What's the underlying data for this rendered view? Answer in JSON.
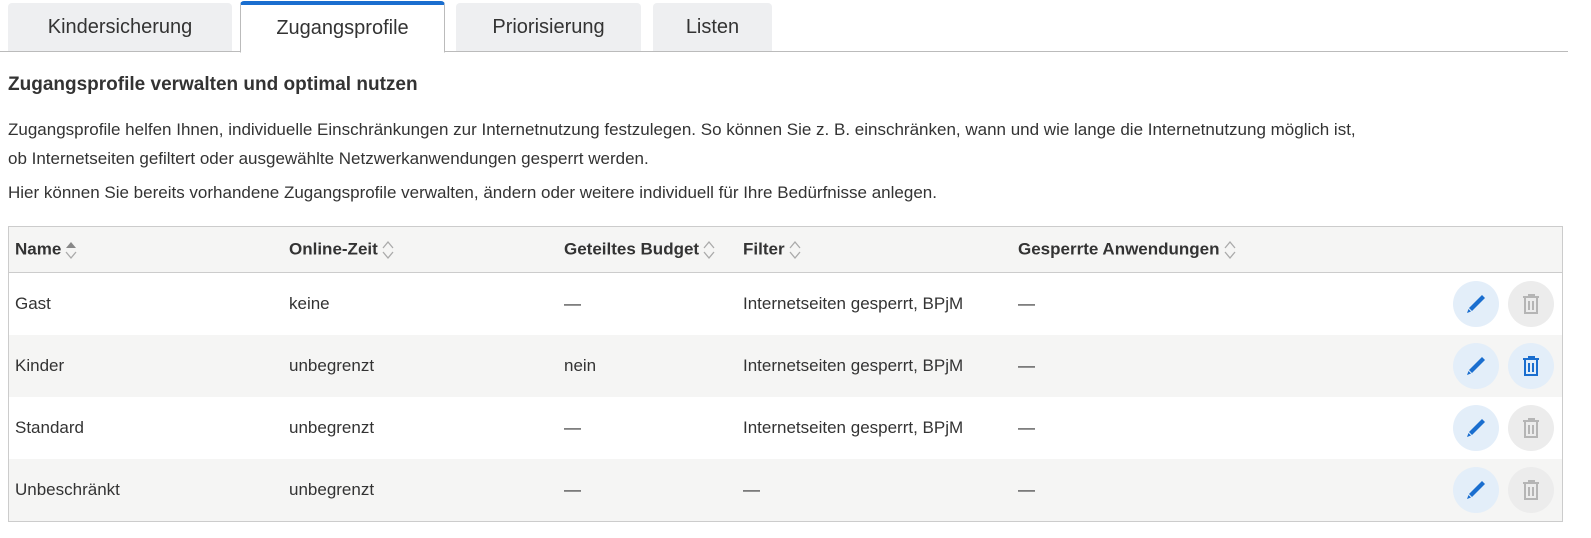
{
  "tabs": [
    {
      "label": "Kindersicherung"
    },
    {
      "label": "Zugangsprofile",
      "active": true
    },
    {
      "label": "Priorisierung"
    },
    {
      "label": "Listen"
    }
  ],
  "heading": "Zugangsprofile verwalten und optimal nutzen",
  "intro1": "Zugangsprofile helfen Ihnen, individuelle Einschränkungen zur Internetnutzung festzulegen. So können Sie z. B. einschränken, wann und wie lange die Internetnutzung möglich ist,",
  "intro2": "ob Internetseiten gefiltert oder ausgewählte Netzwerkanwendungen gesperrt werden.",
  "intro3": "Hier können Sie bereits vorhandene Zugangsprofile verwalten, ändern oder weitere individuell für Ihre Bedürfnisse anlegen.",
  "columns": [
    "Name",
    "Online-Zeit",
    "Geteiltes Budget",
    "Filter",
    "Gesperrte Anwendungen"
  ],
  "rows": [
    {
      "name": "Gast",
      "online": "keine",
      "budget": "—",
      "filter": "Internetseiten gesperrt, BPjM",
      "apps": "—",
      "deletable": false
    },
    {
      "name": "Kinder",
      "online": "unbegrenzt",
      "budget": "nein",
      "filter": "Internetseiten gesperrt, BPjM",
      "apps": "—",
      "deletable": true
    },
    {
      "name": "Standard",
      "online": "unbegrenzt",
      "budget": "—",
      "filter": "Internetseiten gesperrt, BPjM",
      "apps": "—",
      "deletable": false
    },
    {
      "name": "Unbeschränkt",
      "online": "unbegrenzt",
      "budget": "—",
      "filter": "—",
      "apps": "—",
      "deletable": false
    }
  ],
  "colors": {
    "accent": "#1a6ecf",
    "disabled": "#b5b5b5"
  }
}
